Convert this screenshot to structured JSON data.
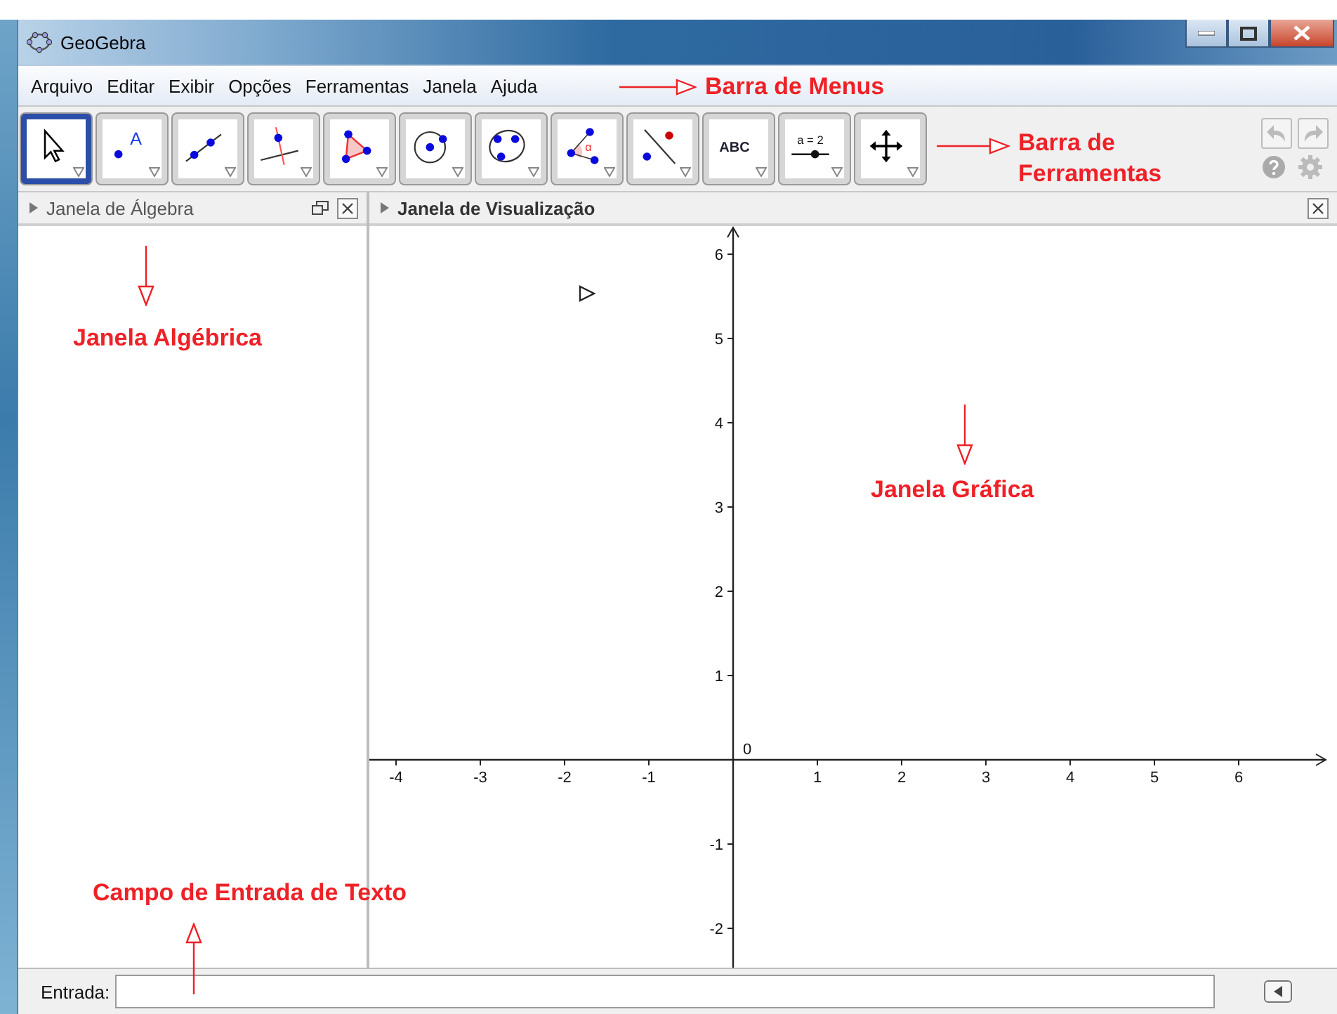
{
  "window": {
    "title": "GeoGebra"
  },
  "menu": [
    "Arquivo",
    "Editar",
    "Exibir",
    "Opções",
    "Ferramentas",
    "Janela",
    "Ajuda"
  ],
  "tools": [
    {
      "kind": "pointer",
      "selected": true
    },
    {
      "kind": "point",
      "label": "A",
      "selected": false
    },
    {
      "kind": "line",
      "selected": false
    },
    {
      "kind": "perpendicular",
      "selected": false
    },
    {
      "kind": "polygon",
      "selected": false
    },
    {
      "kind": "circle",
      "selected": false
    },
    {
      "kind": "conic",
      "selected": false
    },
    {
      "kind": "angle",
      "label": "α",
      "selected": false
    },
    {
      "kind": "reflect",
      "selected": false
    },
    {
      "kind": "text",
      "label": "ABC",
      "selected": false
    },
    {
      "kind": "slider",
      "label": "a = 2",
      "selected": false
    },
    {
      "kind": "move",
      "selected": false
    }
  ],
  "algebra_panel": {
    "title": "Janela de Álgebra"
  },
  "graphics_panel": {
    "title": "Janela de Visualização",
    "x_labels": [
      "-4",
      "-3",
      "-2",
      "-1",
      "0",
      "1",
      "2",
      "3",
      "4",
      "5",
      "6"
    ],
    "y_labels": [
      "6",
      "5",
      "4",
      "3",
      "2",
      "1",
      "-1",
      "-2"
    ]
  },
  "input_bar": {
    "label": "Entrada:"
  },
  "annotations": [
    {
      "text": "Barra de Menus"
    },
    {
      "text": "Barra de Ferramentas"
    },
    {
      "text": "Janela Algébrica"
    },
    {
      "text": "Janela Gráfica"
    },
    {
      "text": "Campo de Entrada de Texto"
    }
  ]
}
